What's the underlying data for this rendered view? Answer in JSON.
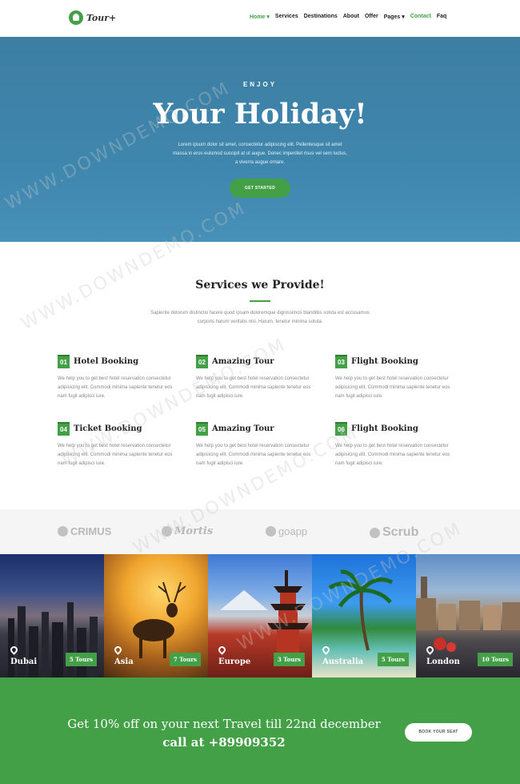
{
  "nav": {
    "logo_text": "Tour+",
    "items": [
      {
        "label": "Home ▾"
      },
      {
        "label": "Services"
      },
      {
        "label": "Destinations"
      },
      {
        "label": "About"
      },
      {
        "label": "Offer"
      },
      {
        "label": "Pages ▾"
      },
      {
        "label": "Contact"
      },
      {
        "label": "Faq"
      }
    ]
  },
  "hero": {
    "eyebrow": "ENJOY",
    "title": "Your Holiday!",
    "text": "Lorem ipsum dolor sit amet, consectetur adipiscing elit. Pellentesque sit amet massa in eros euismod suscipit at ut augue. Donec imperdiet risus vel sem luctus, a viverra augue ornare.",
    "button": "GET STARTED"
  },
  "services": {
    "title": "Services we Provide!",
    "subtitle": "Sapiente dolorum distinctio facere quod ipsam doloremque dignissimos blanditiis soluta est accusamus corporis harum veritatis nisi. Harum, tenetur minima soluta.",
    "items": [
      {
        "num": "01",
        "name": "Hotel Booking",
        "desc": "We help you to get best hotel reservation consectetur adipisicing elit. Commodi minima sapiente tenetur eos nam fugit adipisci iure."
      },
      {
        "num": "02",
        "name": "Amazing Tour",
        "desc": "We help you to get best hotel reservation consectetur adipisicing elit. Commodi minima sapiente tenetur eos nam fugit adipisci iure."
      },
      {
        "num": "03",
        "name": "Flight Booking",
        "desc": "We help you to get best hotel reservation consectetur adipisicing elit. Commodi minima sapiente tenetur eos nam fugit adipisci iure."
      },
      {
        "num": "04",
        "name": "Ticket Booking",
        "desc": "We help you to get best hotel reservation consectetur adipisicing elit. Commodi minima sapiente tenetur eos nam fugit adipisci iure."
      },
      {
        "num": "05",
        "name": "Amazing Tour",
        "desc": "We help you to get best hotel reservation consectetur adipisicing elit. Commodi minima sapiente tenetur eos nam fugit adipisci iure."
      },
      {
        "num": "06",
        "name": "Flight Booking",
        "desc": "We help you to get best hotel reservation consectetur adipisicing elit. Commodi minima sapiente tenetur eos nam fugit adipisci iure."
      }
    ]
  },
  "clients": [
    {
      "name": "CRIMUS"
    },
    {
      "name": "Mortis"
    },
    {
      "name": "goapp"
    },
    {
      "name": "Scrub"
    }
  ],
  "destinations": [
    {
      "name": "Dubai",
      "tours": "5 Tours"
    },
    {
      "name": "Asia",
      "tours": "7 Tours"
    },
    {
      "name": "Europe",
      "tours": "3 Tours"
    },
    {
      "name": "Australia",
      "tours": "5 Tours"
    },
    {
      "name": "London",
      "tours": "10 Tours"
    }
  ],
  "cta": {
    "line1": "Get 10% off on your next Travel till 22nd december",
    "line2": "call at +89909352",
    "button": "BOOK YOUR SEAT"
  },
  "watermark": "WWW.DOWNDEMO.COM",
  "colors": {
    "accent": "#43a047",
    "hero": "#3f86ad"
  }
}
